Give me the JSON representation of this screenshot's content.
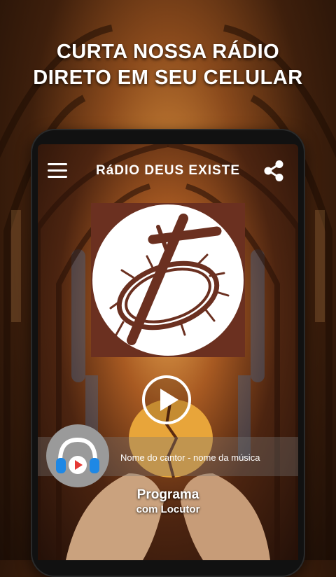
{
  "promo": {
    "line1": "CURTA NOSSA RÁDIO",
    "line2": "DIRETO EM SEU CELULAR"
  },
  "app": {
    "title": "RáDIO DEUS EXISTE",
    "menu_icon": "hamburger-menu-icon",
    "share_icon": "share-icon"
  },
  "player": {
    "play_icon": "play-icon",
    "song": "Nome do cantor - nome da música",
    "program_title": "Programa",
    "program_host": "com Locutor",
    "avatar_icon": "headphones-play-icon"
  },
  "colors": {
    "logo_bg": "#6b3020",
    "logo_circle": "#ffffff",
    "avatar_bg": "#9a9a9a",
    "headphones_blue": "#1e88e5",
    "play_red": "#e53935"
  }
}
